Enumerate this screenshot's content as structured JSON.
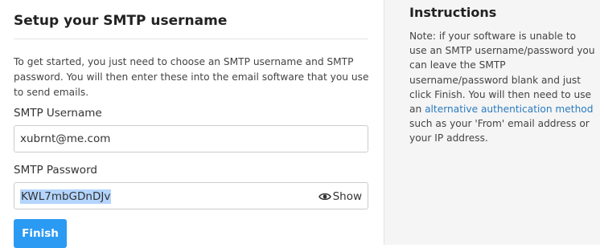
{
  "setup": {
    "title": "Setup your SMTP username",
    "intro": "To get started, you just need to choose an SMTP username and SMTP password. You will then enter these into the email software that you use to send emails.",
    "username_label": "SMTP Username",
    "username_value": "xubrnt@me.com",
    "password_label": "SMTP Password",
    "password_value": "KWL7mbGDnDJv",
    "show_label": "Show",
    "finish_label": "Finish"
  },
  "instructions": {
    "title": "Instructions",
    "text_before": "Note: if your software is unable to use an SMTP username/password you can leave the SMTP username/password blank and just click Finish. You will then need to use an ",
    "link_text": "alternative authentication method",
    "text_after": " such as your 'From' email address or your IP address."
  },
  "icons": {
    "show_icon": "eye-icon"
  },
  "colors": {
    "accent": "#2b9af3",
    "link": "#2a7bbf",
    "sidebar_bg": "#f5f5f5",
    "selection": "#b4d5fe"
  }
}
